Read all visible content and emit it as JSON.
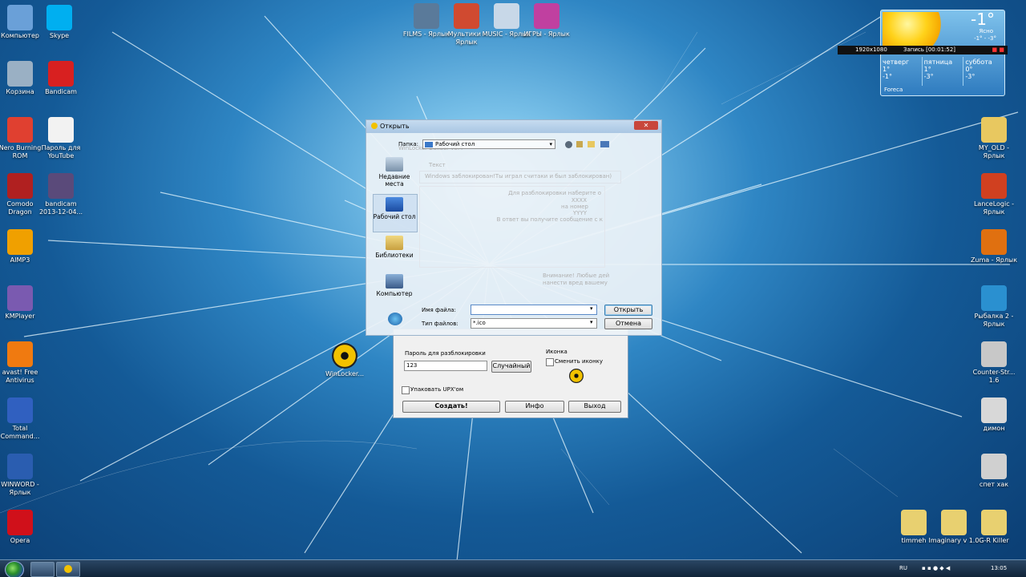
{
  "desktop": {
    "left_icons": [
      {
        "label": "Компьютер",
        "icon": "computer-icon",
        "color": "#6aa0d8"
      },
      {
        "label": "Skype",
        "icon": "skype-icon",
        "color": "#00aff0"
      },
      {
        "label": "Корзина",
        "icon": "recycle-bin-icon",
        "color": "#9ab0c4"
      },
      {
        "label": "Bandicam",
        "icon": "bandicam-icon",
        "color": "#d82020"
      },
      {
        "label": "Nero Burning ROM",
        "icon": "nero-icon",
        "color": "#e04030"
      },
      {
        "label": "Пароль для YouTube",
        "icon": "document-icon",
        "color": "#f2f2f2"
      },
      {
        "label": "Comodo Dragon",
        "icon": "comodo-dragon-icon",
        "color": "#b02020"
      },
      {
        "label": "bandicam 2013-12-04...",
        "icon": "avi-file-icon",
        "color": "#5a4a7a"
      },
      {
        "label": "AIMP3",
        "icon": "aimp-icon",
        "color": "#f0a000"
      },
      {
        "label": "KMPlayer",
        "icon": "kmplayer-icon",
        "color": "#7a5ab0"
      },
      {
        "label": "avast! Free Antivirus",
        "icon": "avast-icon",
        "color": "#f07a10"
      },
      {
        "label": "Total Command...",
        "icon": "total-commander-icon",
        "color": "#3060c0"
      },
      {
        "label": "WINWORD - Ярлык",
        "icon": "word-icon",
        "color": "#2a5db0"
      },
      {
        "label": "Opera",
        "icon": "opera-icon",
        "color": "#d0101a"
      }
    ],
    "top_icons": [
      {
        "label": "FILMS - Ярлык",
        "icon": "monitor-icon",
        "color": "#5a7a9a"
      },
      {
        "label": "Мультики - Ярлык",
        "icon": "house-icon",
        "color": "#d04a30"
      },
      {
        "label": "MUSIC - Ярлык",
        "icon": "cd-icon",
        "color": "#c8d8e8"
      },
      {
        "label": "ИГРЫ - Ярлык",
        "icon": "games-icon",
        "color": "#c040a0"
      }
    ],
    "right_icons": [
      {
        "label": "MY_OLD - Ярлык",
        "icon": "folder-icon",
        "color": "#e8c860"
      },
      {
        "label": "LanceLogic - Ярлык",
        "icon": "lancelogic-icon",
        "color": "#d04020"
      },
      {
        "label": "Zuma - Ярлык",
        "icon": "zuma-icon",
        "color": "#e07010"
      },
      {
        "label": "Рыбалка 2 - Ярлык",
        "icon": "globe-icon",
        "color": "#2a90d0"
      },
      {
        "label": "Counter-Str... 1.6",
        "icon": "counter-strike-icon",
        "color": "#c8c8c8"
      },
      {
        "label": "димон",
        "icon": "cs-player-icon",
        "color": "#d8d8d8"
      },
      {
        "label": "спет хак",
        "icon": "cs-player-icon",
        "color": "#d0d0d0"
      }
    ],
    "bottom_icons": [
      {
        "label": "timmeh",
        "icon": "folder-icon",
        "color": "#e8d070"
      },
      {
        "label": "Imaginary v 1.0",
        "icon": "folder-icon",
        "color": "#e8d070"
      },
      {
        "label": "G-R Killer",
        "icon": "folder-icon",
        "color": "#e8d070"
      }
    ],
    "winlocker_icon": {
      "label": "WinLocker...",
      "icon": "radiation-icon"
    }
  },
  "weather": {
    "temp": "-1°",
    "desc": "Ясно",
    "range": "-1° - -3°",
    "days": [
      {
        "name": "четверг",
        "hi": "1°",
        "lo": "-1°"
      },
      {
        "name": "пятница",
        "hi": "1°",
        "lo": "-3°"
      },
      {
        "name": "суббота",
        "hi": "0°",
        "lo": "-3°"
      }
    ],
    "provider": "Foreca"
  },
  "recorder": {
    "resolution": "1920x1080",
    "status": "Запись [00:01:52]"
  },
  "open_dialog": {
    "title": "Открыть",
    "folder_label": "Папка:",
    "folder_value": "Рабочий стол",
    "nav": [
      {
        "label": "Недавние места",
        "icon": "recent-places-icon"
      },
      {
        "label": "Рабочий стол",
        "icon": "desktop-icon"
      },
      {
        "label": "Библиотеки",
        "icon": "libraries-icon"
      },
      {
        "label": "Компьютер",
        "icon": "computer-icon"
      }
    ],
    "filename_label": "Имя файла:",
    "filename_value": "",
    "filetype_label": "Тип файлов:",
    "filetype_value": "*.ico",
    "open_button": "Открыть",
    "cancel_button": "Отмена"
  },
  "builder": {
    "ghost_title": "WinLocker Builder v0.4",
    "ghost_text_label": "Текст",
    "ghost_main_text": "Windows заблокирован!Ты играл считаки и был заблокирован)",
    "ghost_lines": [
      "Для разблокировки наберите о",
      "XXXX",
      "на номер",
      "YYYY",
      "В ответ вы получите сообщение с к"
    ],
    "ghost_warning": [
      "Внимание! Любые дей",
      "нанести вред вашему"
    ],
    "password_label": "Пароль для разблокировки",
    "password_value": "123",
    "random_button": "Случайный",
    "icon_label": "Иконка",
    "change_icon_label": "Сменить иконку",
    "upx_label": "Упаковать UPX'ом",
    "create_button": "Создать!",
    "info_button": "Инфо",
    "exit_button": "Выход"
  },
  "taskbar": {
    "lang": "RU",
    "time": "13:05"
  }
}
